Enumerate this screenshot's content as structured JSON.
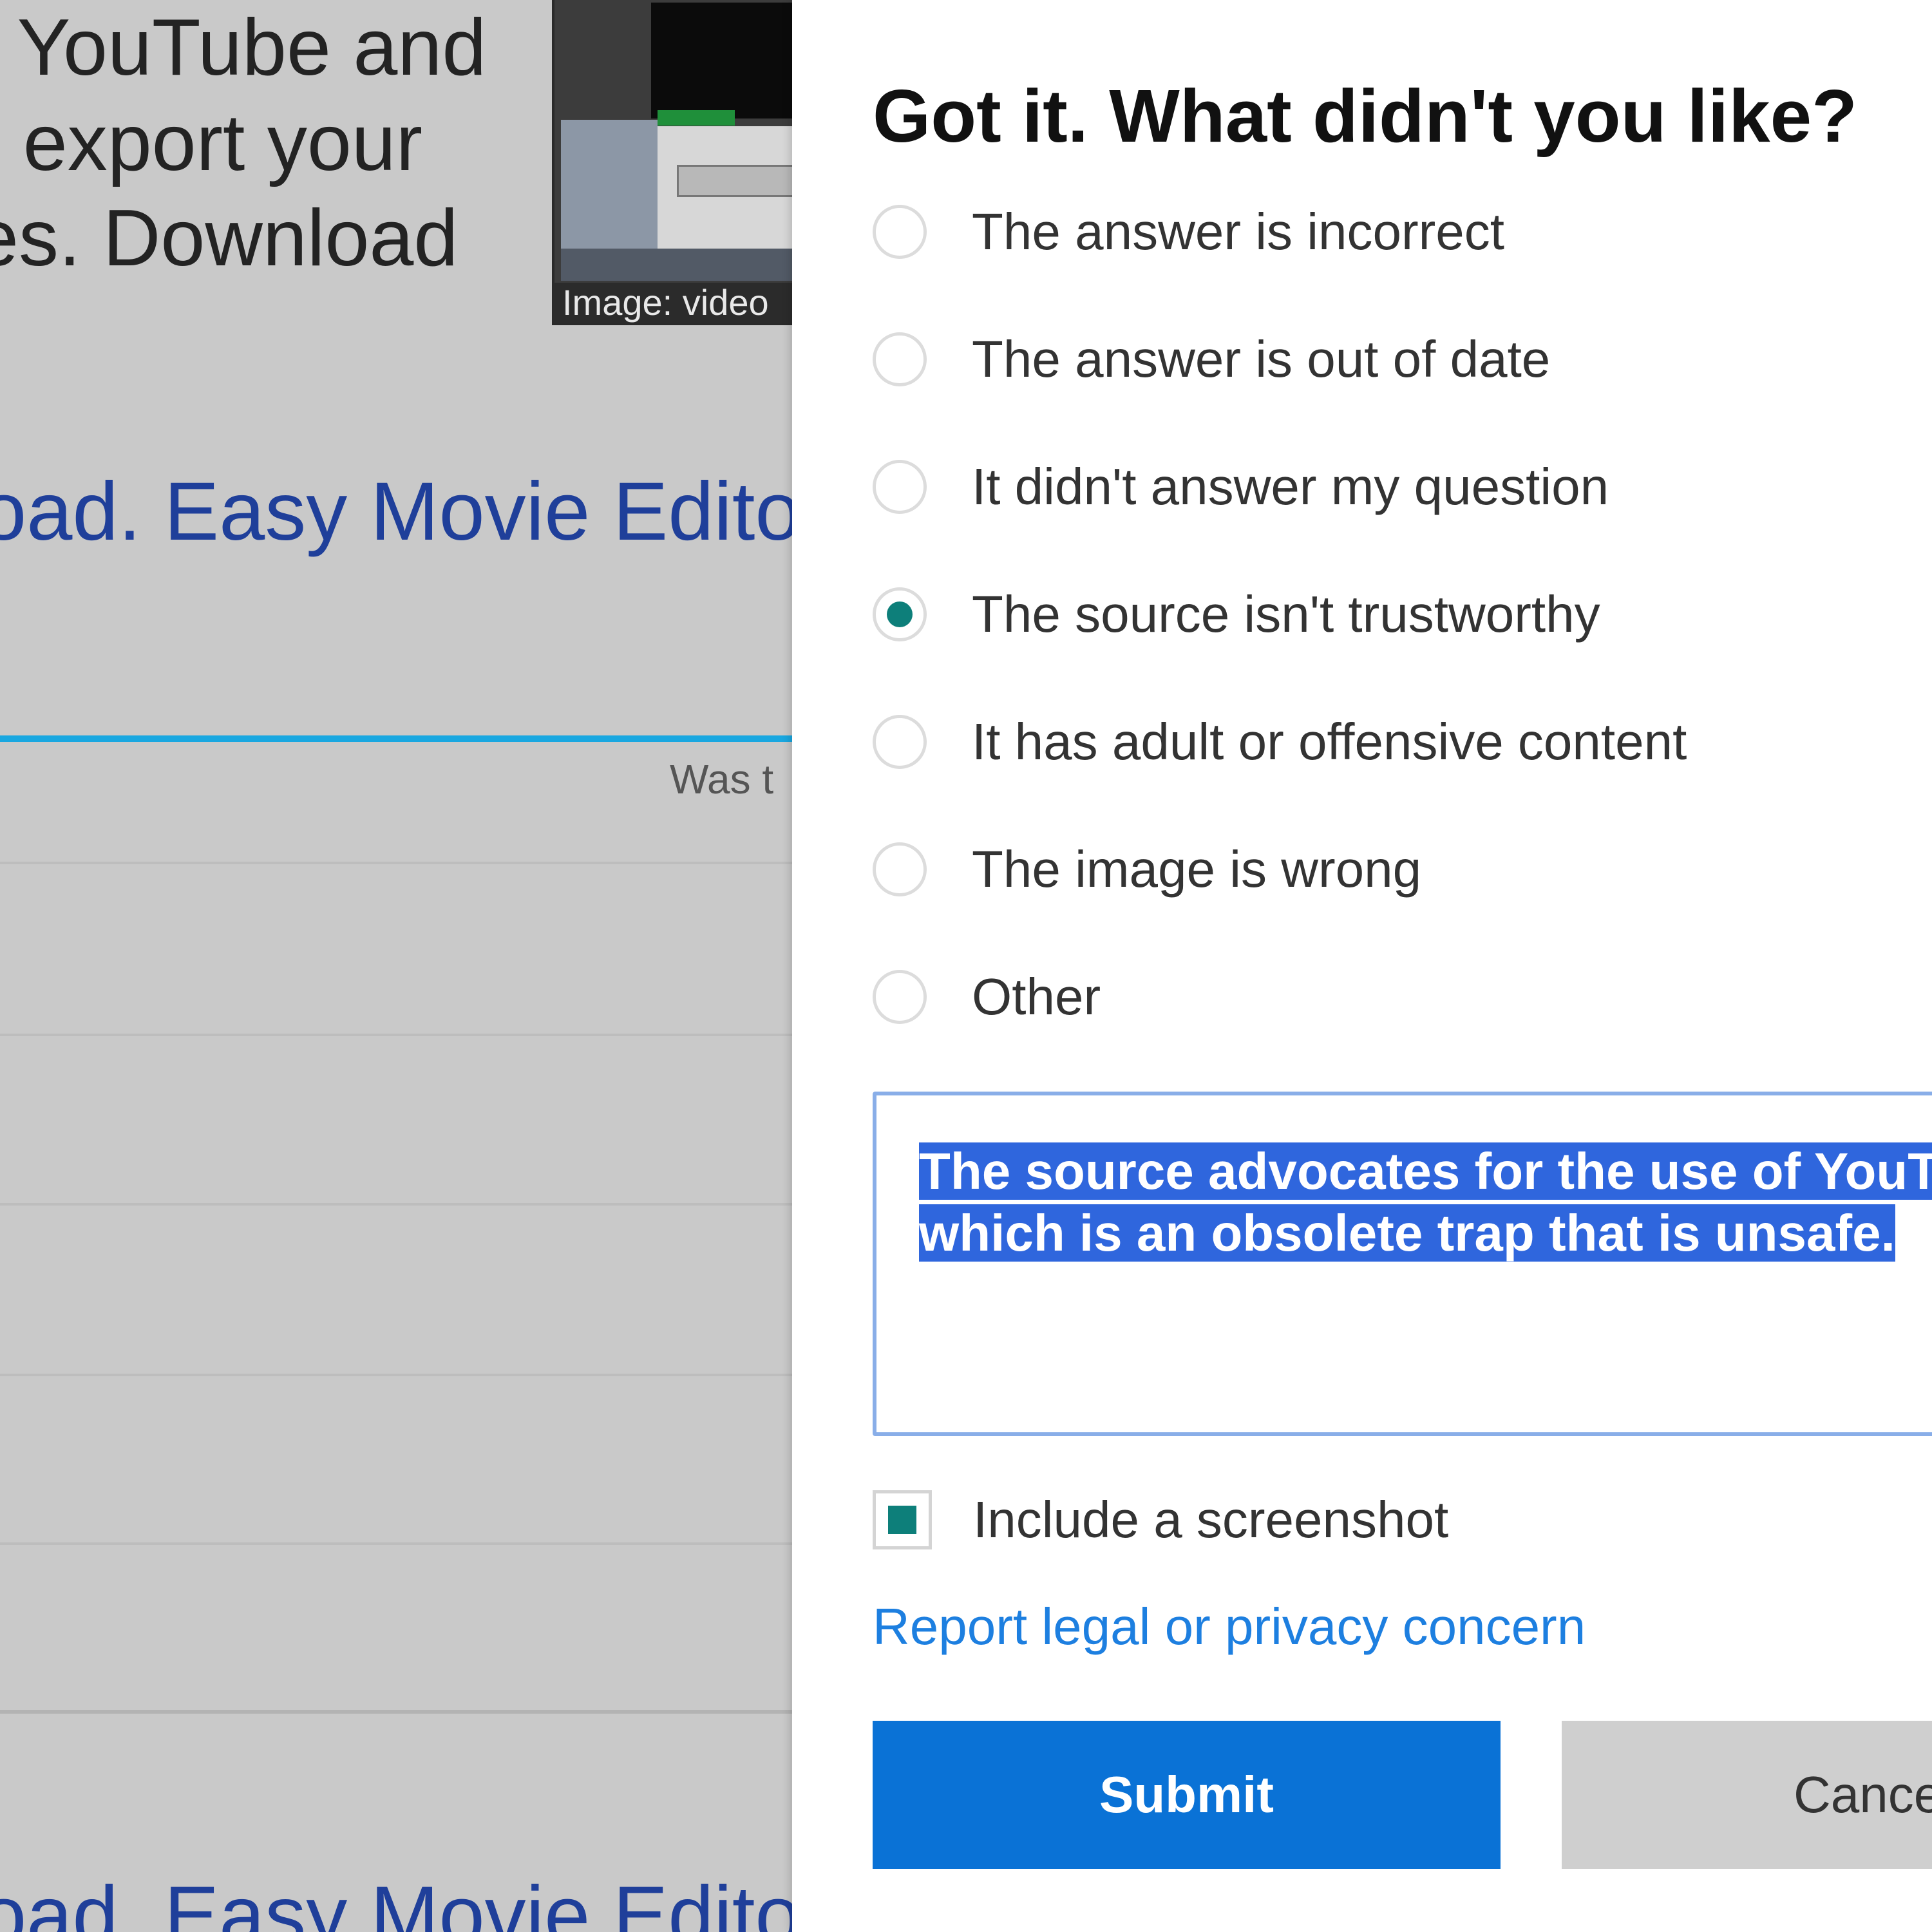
{
  "background": {
    "snippet_lines": [
      ", YouTube and",
      "r export your",
      "es. Download"
    ],
    "thumbnail_caption": "Image: video",
    "result_link_text": "oad. Easy Movie Editor",
    "feedback_prompt": "Was t",
    "accent_color": "#19a7e0",
    "link_color": "#1f3f9a"
  },
  "dialog": {
    "title": "Got it. What didn't you like?",
    "options": [
      {
        "label": "The answer is incorrect",
        "checked": false
      },
      {
        "label": "The answer is out of date",
        "checked": false
      },
      {
        "label": "It didn't answer my question",
        "checked": false
      },
      {
        "label": "The source isn't trustworthy",
        "checked": true
      },
      {
        "label": "It has adult or offensive content",
        "checked": false
      },
      {
        "label": "The image is wrong",
        "checked": false
      },
      {
        "label": "Other",
        "checked": false
      }
    ],
    "comment": {
      "line1": "The source advocates for the use of YouTu",
      "line2": "which is an obsolete trap that is unsafe."
    },
    "include_screenshot": {
      "label": "Include a screenshot",
      "checked": true
    },
    "legal_link": "Report legal or privacy concern",
    "submit_label": "Submit",
    "cancel_label": "Cancel",
    "colors": {
      "primary": "#0a72d6",
      "radio_checked": "#0d7f7a",
      "link": "#1d7fe0",
      "selection": "#2f66dd"
    }
  }
}
